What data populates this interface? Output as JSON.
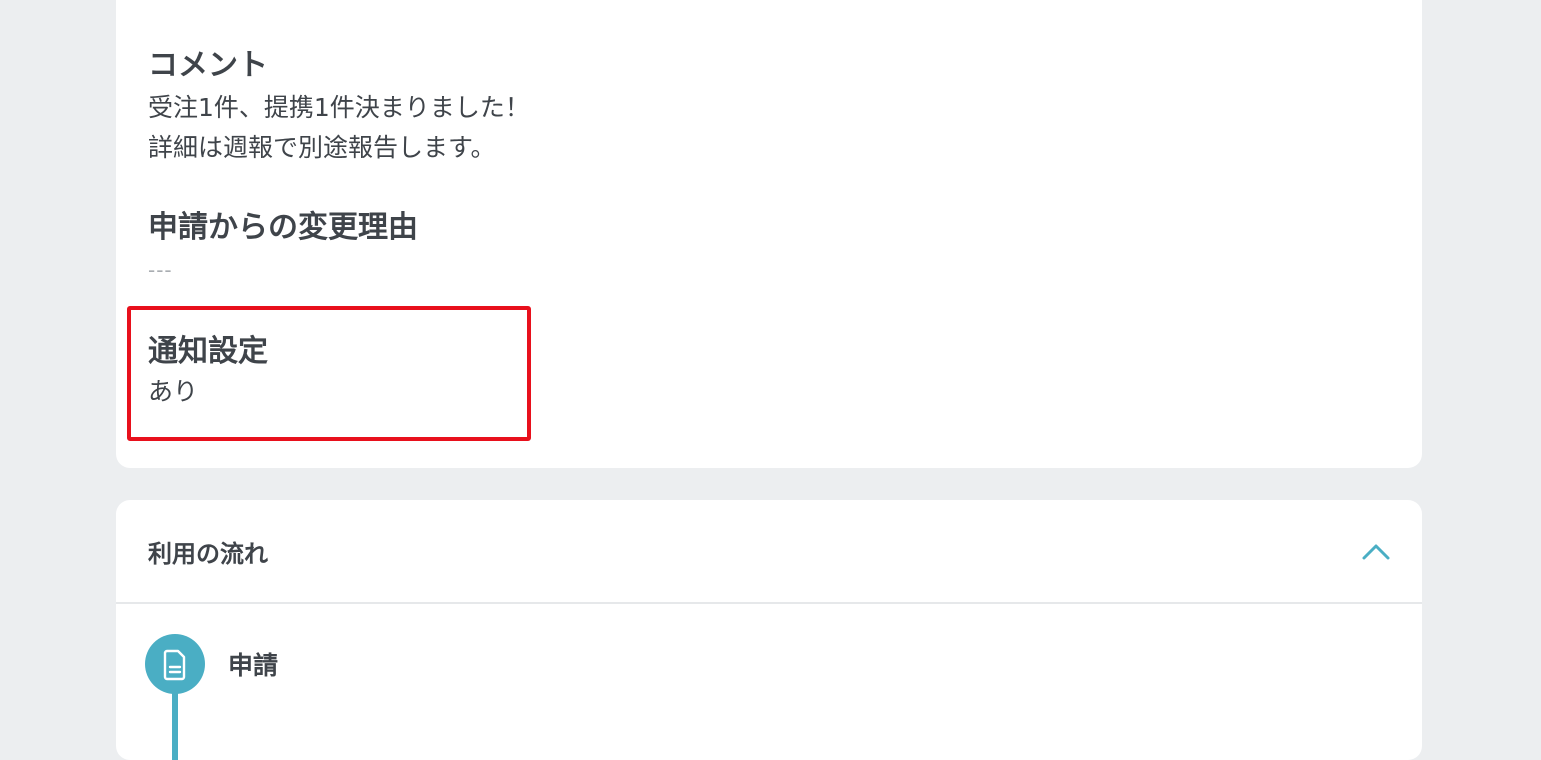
{
  "detail": {
    "comment": {
      "heading": "コメント",
      "lines": [
        "受注1件、提携1件決まりました！",
        "詳細は週報で別途報告します。"
      ]
    },
    "change_reason": {
      "heading": "申請からの変更理由",
      "value": "---"
    },
    "notification": {
      "heading": "通知設定",
      "value": "あり"
    }
  },
  "flow": {
    "title": "利用の流れ",
    "toggle_icon": "chevron-up-icon",
    "steps": [
      {
        "label": "申請",
        "icon": "document-icon"
      }
    ]
  },
  "colors": {
    "accent": "#4aaec4",
    "highlight": "#e8101c",
    "background": "#eceef0"
  }
}
